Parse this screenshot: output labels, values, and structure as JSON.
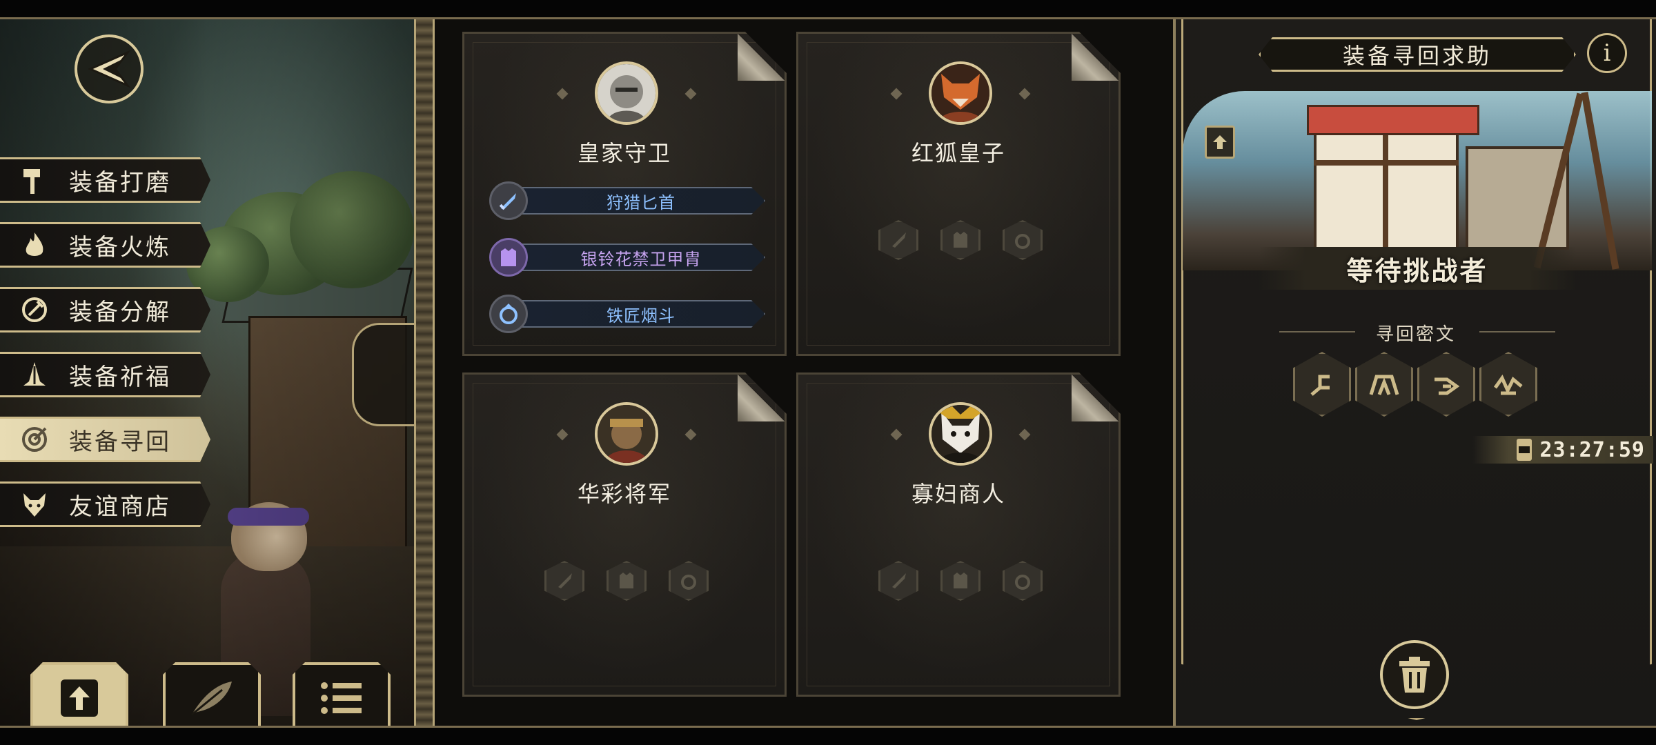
{
  "menu": {
    "items": [
      {
        "label": "装备打磨",
        "icon": "hammer-icon"
      },
      {
        "label": "装备火炼",
        "icon": "flame-icon"
      },
      {
        "label": "装备分解",
        "icon": "disassemble-icon"
      },
      {
        "label": "装备祈福",
        "icon": "pray-icon"
      },
      {
        "label": "装备寻回",
        "icon": "target-icon",
        "active": true
      },
      {
        "label": "友谊商店",
        "icon": "fox-icon"
      }
    ]
  },
  "bottom_buttons": [
    "upload-icon",
    "feather-icon",
    "list-icon"
  ],
  "cards": [
    {
      "name": "皇家守卫",
      "avatar": "knight-portrait",
      "equipment": [
        {
          "label": "狩猎匕首",
          "icon": "dagger-icon",
          "rarity_color": "#8ec1ff"
        },
        {
          "label": "银铃花禁卫甲胄",
          "icon": "armor-icon",
          "rarity_color": "#c7a4f0"
        },
        {
          "label": "铁匠烟斗",
          "icon": "ring-icon",
          "rarity_color": "#8ec1ff"
        }
      ]
    },
    {
      "name": "红狐皇子",
      "avatar": "red-fox-portrait",
      "empty_slots": [
        "weapon-slot-icon",
        "armor-slot-icon",
        "ring-slot-icon"
      ]
    },
    {
      "name": "华彩将军",
      "avatar": "general-portrait",
      "empty_slots": [
        "weapon-slot-icon",
        "armor-slot-icon",
        "ring-slot-icon"
      ]
    },
    {
      "name": "寡妇商人",
      "avatar": "widow-merchant-portrait",
      "empty_slots": [
        "weapon-slot-icon",
        "armor-slot-icon",
        "ring-slot-icon"
      ]
    }
  ],
  "panel": {
    "title": "装备寻回求助",
    "info_label": "i",
    "status": "等待挑战者",
    "cipher_label": "寻回密文",
    "runes": [
      "rune-1-icon",
      "rune-2-icon",
      "rune-3-icon",
      "rune-4-icon"
    ],
    "timer": "23:27:59"
  },
  "colors": {
    "gold": "#cdbb8a",
    "blue_item": "#8ec1ff",
    "purple_item": "#c7a4f0"
  }
}
